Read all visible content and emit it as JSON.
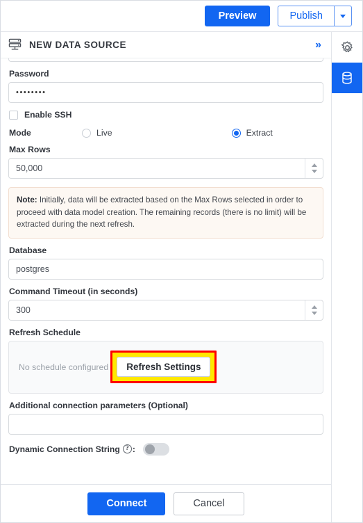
{
  "topbar": {
    "preview_label": "Preview",
    "publish_label": "Publish",
    "caret_icon": "chevron-down-icon",
    "accent_color": "#1266f1"
  },
  "panel": {
    "title": "NEW DATA SOURCE",
    "title_icon": "server-rack-icon",
    "expand_icon": "double-chevron-right-icon",
    "expand_glyph": "»"
  },
  "form": {
    "password": {
      "label": "Password",
      "value": "••••••••"
    },
    "enable_ssh": {
      "label": "Enable SSH",
      "checked": false
    },
    "mode": {
      "label": "Mode",
      "options": [
        {
          "label": "Live",
          "selected": false
        },
        {
          "label": "Extract",
          "selected": true
        }
      ]
    },
    "max_rows": {
      "label": "Max Rows",
      "value": "50,000"
    },
    "note": {
      "prefix": "Note:",
      "text": " Initially, data will be extracted based on the Max Rows selected in order to proceed with data model creation. The remaining records (there is no limit) will be extracted during the next refresh."
    },
    "database": {
      "label": "Database",
      "value": "postgres"
    },
    "command_timeout": {
      "label": "Command Timeout (in seconds)",
      "value": "300"
    },
    "refresh_schedule": {
      "label": "Refresh Schedule",
      "empty_text": "No schedule configured",
      "button_label": "Refresh Settings",
      "highlight_border_color": "#fe0000",
      "highlight_fill_color": "#ffe800"
    },
    "additional_params": {
      "label": "Additional connection parameters (Optional)",
      "value": ""
    },
    "dynamic_connection_string": {
      "label": "Dynamic Connection String",
      "help_icon": "question-mark-icon",
      "help_glyph": "?",
      "colon": ":",
      "enabled": false
    }
  },
  "footer": {
    "connect_label": "Connect",
    "cancel_label": "Cancel"
  },
  "rail": {
    "items": [
      {
        "name": "settings",
        "icon": "gear-icon",
        "active": false
      },
      {
        "name": "data-sources",
        "icon": "database-icon",
        "active": true
      }
    ]
  }
}
